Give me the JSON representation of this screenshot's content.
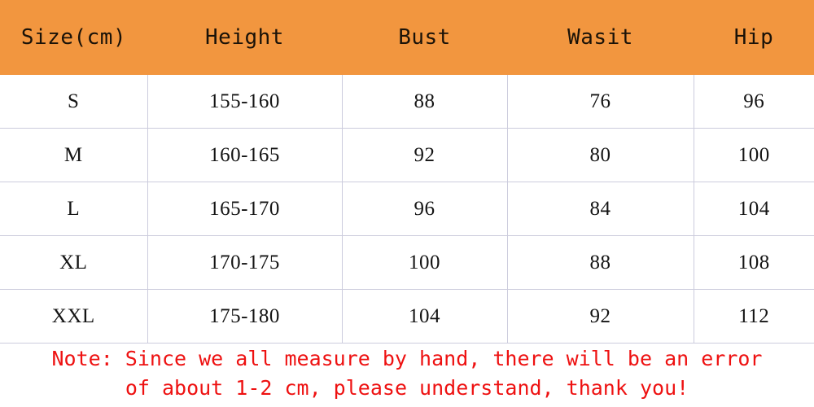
{
  "table": {
    "columns": [
      {
        "key": "size",
        "label": "Size(cm)"
      },
      {
        "key": "height",
        "label": "Height"
      },
      {
        "key": "bust",
        "label": "Bust"
      },
      {
        "key": "waist",
        "label": "Wasit"
      },
      {
        "key": "hip",
        "label": "Hip"
      }
    ],
    "rows": [
      {
        "size": "S",
        "height": "155-160",
        "bust": "88",
        "waist": "76",
        "hip": "96"
      },
      {
        "size": "M",
        "height": "160-165",
        "bust": "92",
        "waist": "80",
        "hip": "100"
      },
      {
        "size": "L",
        "height": "165-170",
        "bust": "96",
        "waist": "84",
        "hip": "104"
      },
      {
        "size": "XL",
        "height": "170-175",
        "bust": "100",
        "waist": "88",
        "hip": "108"
      },
      {
        "size": "XXL",
        "height": "175-180",
        "bust": "104",
        "waist": "92",
        "hip": "112"
      }
    ]
  },
  "note": {
    "line_1": "Note: Since we all measure by hand, there will be an error",
    "line_2": "of about 1-2 cm, please understand, thank you!"
  },
  "colors": {
    "header_background": "#f2963f",
    "header_text": "#1a1208",
    "cell_text": "#141414",
    "grid_line": "#ccccdd",
    "note_text": "#ee1111",
    "page_background": "#ffffff"
  }
}
